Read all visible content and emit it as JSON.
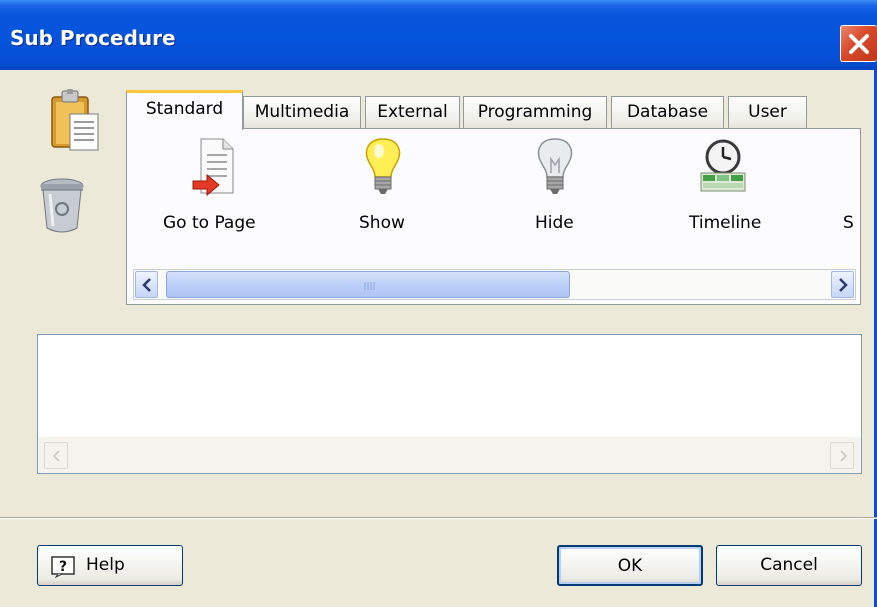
{
  "window": {
    "title": "Sub Procedure",
    "close_icon": "close-icon"
  },
  "sidebar_icons": [
    {
      "name": "paste-icon"
    },
    {
      "name": "recycle-bin-icon"
    }
  ],
  "tabs": [
    {
      "label": "Standard",
      "active": true
    },
    {
      "label": "Multimedia",
      "active": false
    },
    {
      "label": "External",
      "active": false
    },
    {
      "label": "Programming",
      "active": false
    },
    {
      "label": "Database",
      "active": false
    },
    {
      "label": "User",
      "active": false
    }
  ],
  "tools": [
    {
      "label": "Go to Page",
      "icon": "go-to-page-icon"
    },
    {
      "label": "Show",
      "icon": "lightbulb-on-icon"
    },
    {
      "label": "Hide",
      "icon": "lightbulb-off-icon"
    },
    {
      "label": "Timeline",
      "icon": "timeline-icon"
    },
    {
      "label": "S",
      "icon": ""
    }
  ],
  "buttons": {
    "help": "Help",
    "ok": "OK",
    "cancel": "Cancel"
  },
  "colors": {
    "titlebar": "#0454dc",
    "dialog_bg": "#ece9d8",
    "active_tab_accent": "#ffc83c",
    "close_button": "#d8492a"
  }
}
